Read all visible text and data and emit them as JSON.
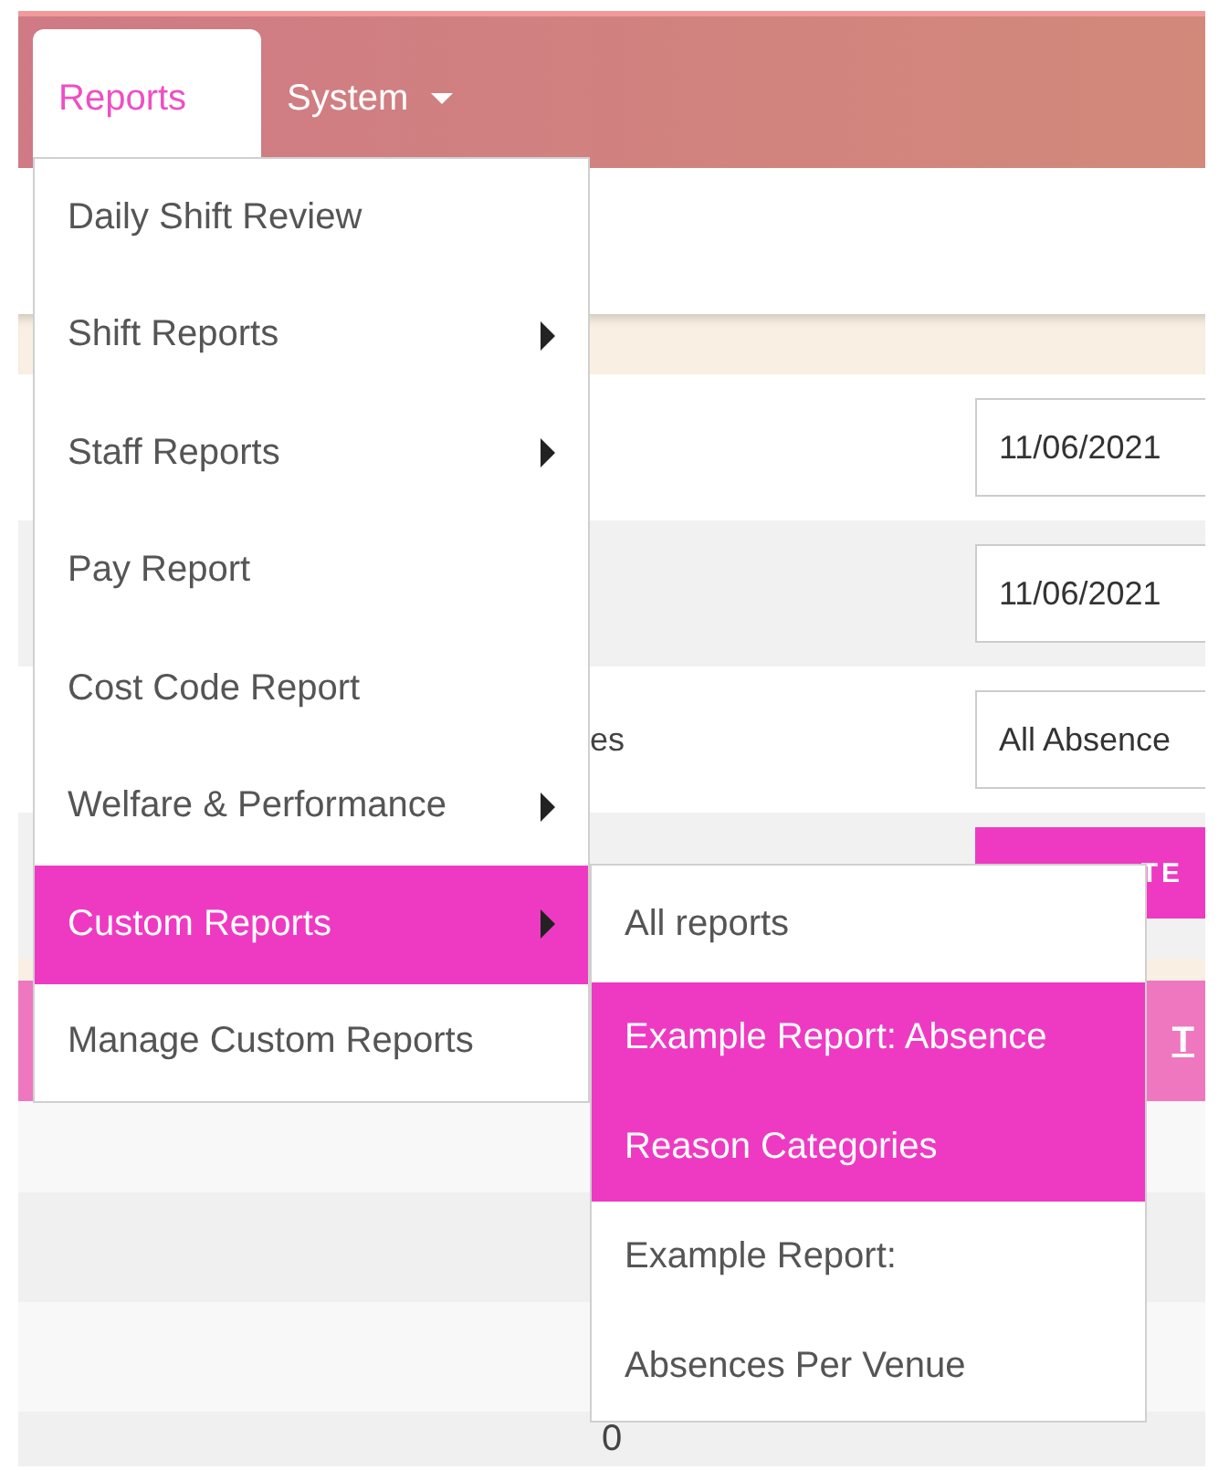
{
  "navbar": {
    "tabs": [
      {
        "label": "Reports",
        "selected": true,
        "dropdown": false
      },
      {
        "label": "System",
        "selected": false,
        "dropdown": true
      }
    ]
  },
  "form": {
    "rows": [
      {
        "kind": "field",
        "value": "11/06/2021"
      },
      {
        "kind": "field",
        "value": "11/06/2021"
      },
      {
        "label": "es",
        "kind": "select",
        "value": "All Absence"
      },
      {
        "kind": "button",
        "value": "TE"
      }
    ]
  },
  "table": {
    "header": [
      {
        "text": "T"
      }
    ],
    "rows": [
      {
        "value": ""
      },
      {
        "value": ""
      },
      {
        "value": ""
      },
      {
        "value": "0"
      }
    ]
  },
  "menu": {
    "items": [
      {
        "label": "Daily Shift Review",
        "submenu": false,
        "selected": false
      },
      {
        "label": "Shift Reports",
        "submenu": true,
        "selected": false
      },
      {
        "label": "Staff Reports",
        "submenu": true,
        "selected": false
      },
      {
        "label": "Pay Report",
        "submenu": false,
        "selected": false
      },
      {
        "label": "Cost Code Report",
        "submenu": false,
        "selected": false
      },
      {
        "label": "Welfare & Performance",
        "submenu": true,
        "selected": false
      },
      {
        "label": "Custom Reports",
        "submenu": true,
        "selected": true
      },
      {
        "label": "Manage Custom Reports",
        "submenu": false,
        "selected": false
      }
    ]
  },
  "submenu": {
    "items": [
      {
        "lines": [
          "All reports"
        ],
        "selected": false
      },
      {
        "lines": [
          "Example Report: Absence",
          "Reason Categories"
        ],
        "selected": true
      },
      {
        "lines": [
          "Example Report:",
          "Absences Per Venue"
        ],
        "selected": false
      }
    ]
  }
}
